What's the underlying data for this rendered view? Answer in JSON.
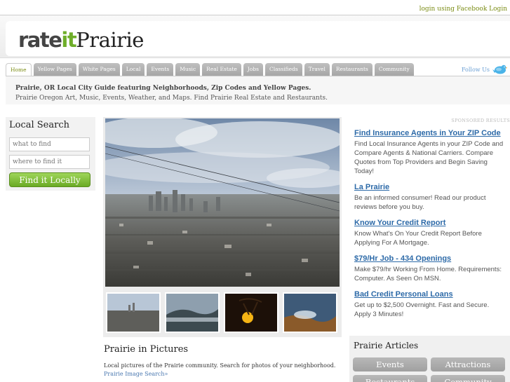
{
  "topbar": {
    "facebook_link": "login using Facebook Login"
  },
  "logo": {
    "part1": "rate",
    "part2": "it",
    "part3": "Prairie"
  },
  "nav": {
    "tabs": [
      "Home",
      "Yellow Pages",
      "White Pages",
      "Local",
      "Events",
      "Music",
      "Real Estate",
      "Jobs",
      "Classifieds",
      "Travel",
      "Restaurants",
      "Community"
    ],
    "active_index": 0,
    "follow_label": "Follow Us"
  },
  "description": {
    "title": "Prairie, OR Local City Guide featuring Neighborhoods, Zip Codes and Yellow Pages.",
    "subtitle": "Prairie Oregon Art, Music, Events, Weather, and Maps. Find Prairie Real Estate and Restaurants."
  },
  "search": {
    "heading": "Local Search",
    "what_placeholder": "what to find",
    "where_placeholder": "where to find it",
    "button_label": "Find it Locally"
  },
  "pictures": {
    "title": "Prairie in Pictures",
    "text": "Local pictures of the Prairie community. Search for photos of your neighborhood.",
    "link": "Prairie Image Search»"
  },
  "sponsored": {
    "label": "SPONSORED RESULTS",
    "ads": [
      {
        "title": "Find Insurance Agents in Your ZIP Code",
        "text": "Find Local Insurance Agents in your ZIP Code and Compare Agents & National Carriers. Compare Quotes from Top Providers and Begin Saving Today!"
      },
      {
        "title": "La Prairie",
        "text": "Be an informed consumer! Read our product reviews before you buy."
      },
      {
        "title": "Know Your Credit Report",
        "text": "Know What's On Your Credit Report Before Applying For A Mortgage."
      },
      {
        "title": "$79/Hr Job - 434 Openings",
        "text": "Make $79/hr Working From Home. Requirements: Computer. As Seen On MSN."
      },
      {
        "title": "Bad Credit Personal Loans",
        "text": "Get up to $2,500 Overnight. Fast and Secure. Apply 3 Minutes!"
      }
    ]
  },
  "articles": {
    "title": "Prairie Articles",
    "buttons": [
      "Events",
      "Attractions",
      "Restaurants",
      "Community"
    ]
  }
}
